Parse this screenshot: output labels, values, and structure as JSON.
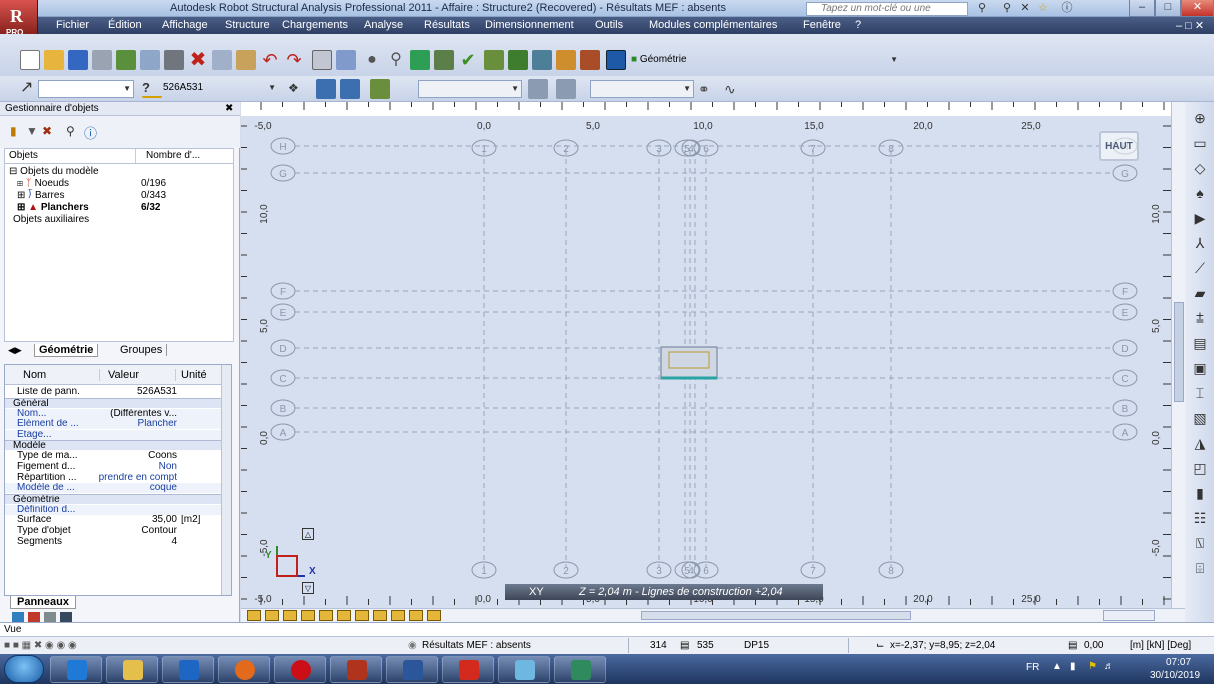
{
  "window": {
    "title": "Autodesk Robot Structural Analysis Professional 2011 - Affaire : Structure2 (Recovered) - Résultats MEF : absents",
    "search_placeholder": "Tapez un mot-clé ou une expression",
    "logo_label": "PRO"
  },
  "menu": [
    "Fichier",
    "Édition",
    "Affichage",
    "Structure",
    "Chargements",
    "Analyse",
    "Résultats",
    "Dimensionnement",
    "Outils",
    "Modules complémentaires",
    "Fenêtre",
    "?"
  ],
  "toolbar": {
    "layout_combo": "Géométrie",
    "selection_combo": "526A531",
    "help_symbol": "?"
  },
  "object_manager": {
    "title": "Gestionnaire d'objets",
    "columns": [
      "Objets",
      "Nombre d'..."
    ],
    "tree": [
      {
        "label": "Objets du modèle",
        "count": ""
      },
      {
        "label": "Noeuds",
        "count": "0/196"
      },
      {
        "label": "Barres",
        "count": "0/343"
      },
      {
        "label": "Planchers",
        "count": "6/32"
      },
      {
        "label": "Objets auxiliaires",
        "count": ""
      }
    ],
    "tabs": [
      "Géométrie",
      "Groupes"
    ]
  },
  "properties": {
    "headers": [
      "Nom",
      "Valeur",
      "Unité"
    ],
    "rows": [
      {
        "name": "Liste de pann...",
        "value": "526A531",
        "unit": "",
        "type": "row"
      },
      {
        "name": "Général",
        "value": "",
        "unit": "",
        "type": "sec"
      },
      {
        "name": "Nom...",
        "value": "(Différentes v...",
        "unit": "",
        "type": "sub"
      },
      {
        "name": "Élément de ...",
        "value": "Plancher",
        "unit": "",
        "type": "sub"
      },
      {
        "name": "Etage...",
        "value": "",
        "unit": "",
        "type": "sub"
      },
      {
        "name": "Modèle",
        "value": "",
        "unit": "",
        "type": "sec"
      },
      {
        "name": "Type de ma...",
        "value": "Coons",
        "unit": "",
        "type": "row"
      },
      {
        "name": "Figement d...",
        "value": "Non",
        "unit": "",
        "type": "row"
      },
      {
        "name": "Répartition ...",
        "value": "prendre en compt",
        "unit": "",
        "type": "row"
      },
      {
        "name": "Modèle de ...",
        "value": "coque",
        "unit": "",
        "type": "sub"
      },
      {
        "name": "Géométrie",
        "value": "",
        "unit": "",
        "type": "sec"
      },
      {
        "name": "Définition d...",
        "value": "",
        "unit": "",
        "type": "sub"
      },
      {
        "name": "Surface",
        "value": "35,00",
        "unit": "[m2]",
        "type": "row"
      },
      {
        "name": "Type d'objet",
        "value": "Contour",
        "unit": "",
        "type": "row"
      },
      {
        "name": "Segments",
        "value": "4",
        "unit": "",
        "type": "row"
      }
    ],
    "tab": "Panneaux"
  },
  "viewport": {
    "x_ticks": [
      "-5,0",
      "0,0",
      "5,0",
      "10,0",
      "15,0",
      "20,0",
      "25,0"
    ],
    "y_ticks": [
      "10,0",
      "5,0",
      "0,0",
      "-5,0"
    ],
    "col_axes": [
      "1",
      "2",
      "3",
      "4",
      "5",
      "6",
      "7",
      "8"
    ],
    "row_axes": [
      "H",
      "G",
      "F",
      "E",
      "D",
      "C",
      "B",
      "A"
    ],
    "view_cube": "HAUT",
    "view_plane": "XY",
    "level_info": "Z = 2,04 m - Lignes de construction +2,04",
    "axis_y": "Y",
    "axis_x": "X"
  },
  "vue_label": "Vue",
  "status": {
    "results": "Résultats MEF : absents",
    "nodes": "314",
    "bars": "535",
    "section": "DP15",
    "coords": "x=-2,37; y=8,95; z=2,04",
    "value": "0,00",
    "units": "[m] [kN] [Deg]"
  },
  "taskbar": {
    "lang": "FR",
    "time": "07:07",
    "date": "30/10/2019"
  }
}
